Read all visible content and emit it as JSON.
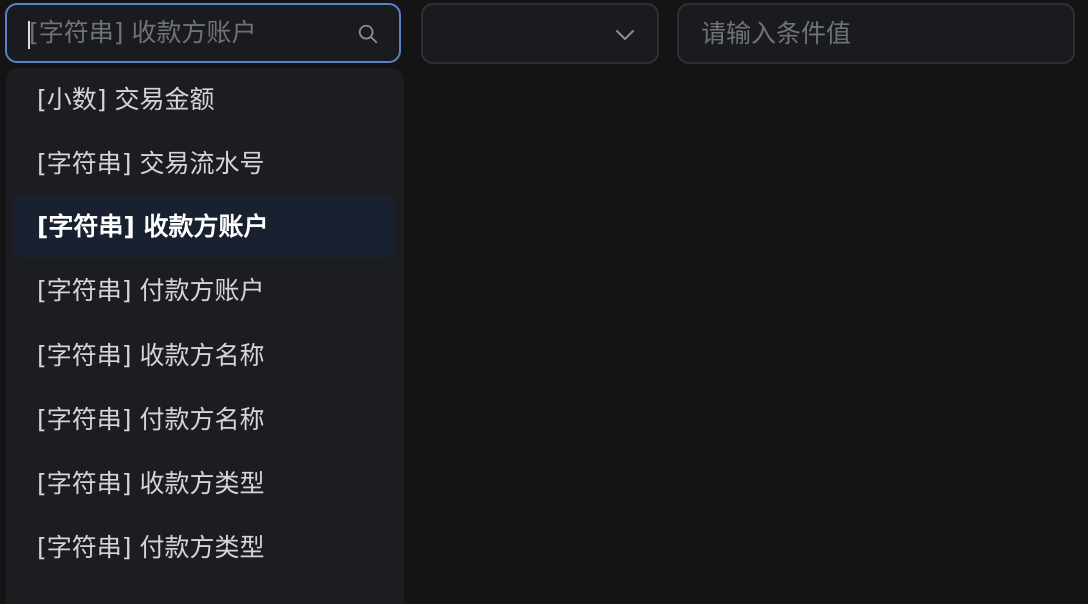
{
  "filter": {
    "field_select": {
      "placeholder": "[字符串] 收款方账户",
      "icon": "search-icon"
    },
    "operator_select": {
      "value": "",
      "icon": "chevron-down-icon"
    },
    "value_input": {
      "placeholder": "请输入条件值"
    }
  },
  "dropdown": {
    "options": [
      {
        "label": "[小数] 交易金额"
      },
      {
        "label": "[字符串] 交易流水号"
      },
      {
        "label": "[字符串] 收款方账户",
        "selected": true
      },
      {
        "label": "[字符串] 付款方账户"
      },
      {
        "label": "[字符串] 收款方名称"
      },
      {
        "label": "[字符串] 付款方名称"
      },
      {
        "label": "[字符串] 收款方类型"
      },
      {
        "label": "[字符串] 付款方类型"
      }
    ]
  },
  "colors": {
    "background": "#141414",
    "input_bg": "#1a1b1e",
    "focus_border": "#5b80c9",
    "selected_option_bg": "#192130",
    "placeholder_text": "#6f7277",
    "option_text": "#d4d5d8"
  }
}
